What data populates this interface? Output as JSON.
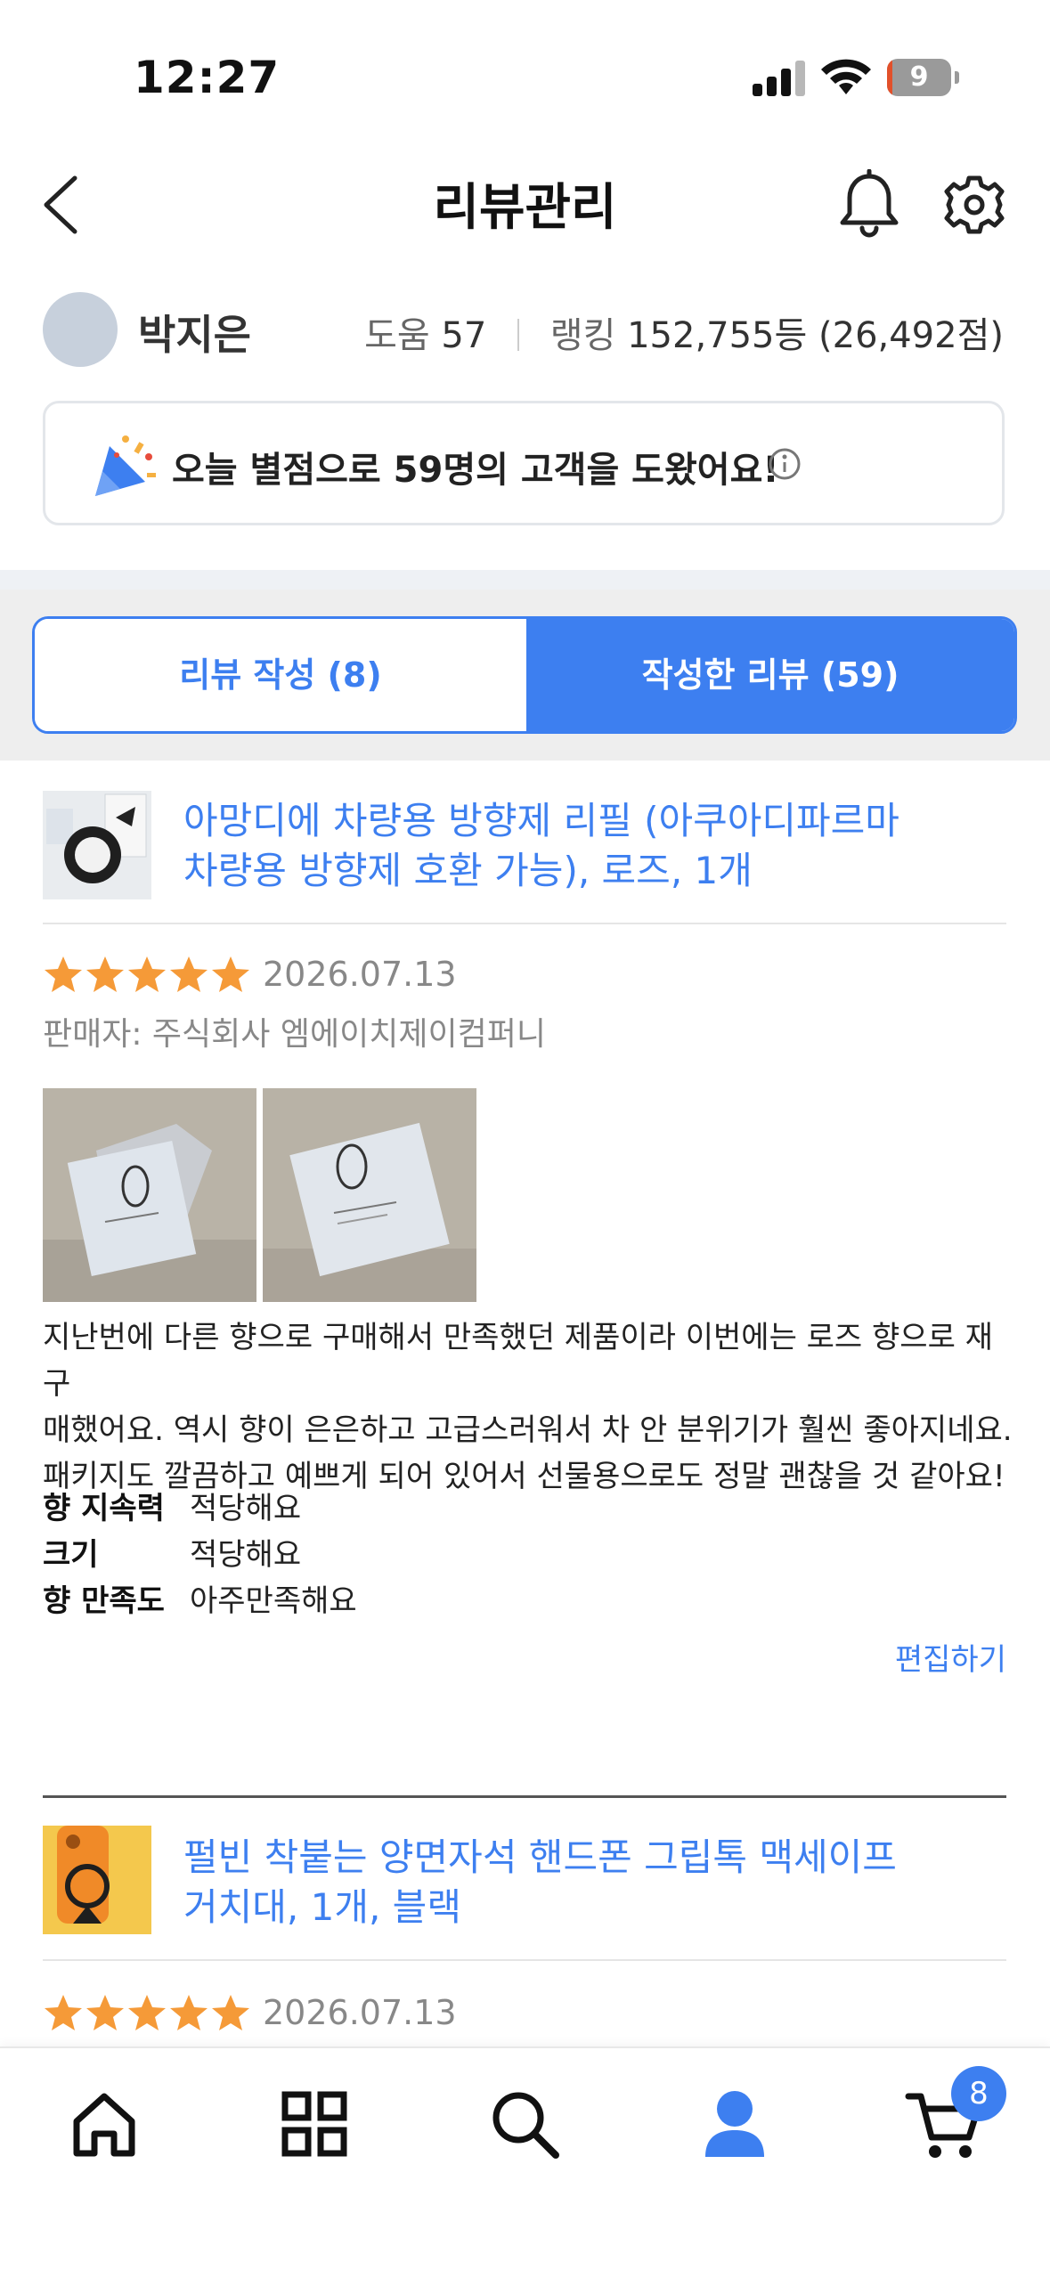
{
  "status_bar": {
    "time": "12:27",
    "battery": "9",
    "battery_level": 0.09
  },
  "header": {
    "title": "리뷰관리"
  },
  "profile": {
    "name": "박지은",
    "help_label": "도움",
    "help_count": "57",
    "ranking_label": "랭킹",
    "ranking_value": "152,755등 (26,492점)"
  },
  "banner": {
    "text": "오늘 별점으로 59명의 고객을 도왔어요!"
  },
  "tabs": [
    {
      "label": "리뷰 작성 (8)",
      "active": false
    },
    {
      "label": "작성한 리뷰 (59)",
      "active": true
    }
  ],
  "reviews": [
    {
      "product_title_line1": "아망디에 차량용 방향제 리필 (아쿠아디파르마",
      "product_title_line2": "차량용 방향제 호환 가능), 로즈, 1개",
      "rating": 5,
      "date": "2026.07.13",
      "seller": "판매자: 주식회사 엠에이치제이컴퍼니",
      "body_lines": [
        "지난번에 다른 향으로 구매해서 만족했던 제품이라 이번에는 로즈 향으로 재구",
        "매했어요. 역시 향이 은은하고 고급스러워서 차 안 분위기가 훨씬 좋아지네요.",
        "패키지도 깔끔하고 예쁘게 되어 있어서 선물용으로도 정말 괜찮을 것 같아요!"
      ],
      "attributes": [
        {
          "key": "향 지속력",
          "value": "적당해요"
        },
        {
          "key": "크기",
          "value": "적당해요"
        },
        {
          "key": "향 만족도",
          "value": "아주만족해요"
        }
      ],
      "edit_label": "편집하기"
    },
    {
      "product_title_line1": "펄빈 착붙는 양면자석 핸드폰 그립톡 맥세이프",
      "product_title_line2": "거치대, 1개, 블랙",
      "rating": 5,
      "date": "2026.07.13"
    }
  ],
  "bottom_nav": {
    "items": [
      "home-icon",
      "categories-icon",
      "search-icon",
      "my-page-icon",
      "cart-icon"
    ],
    "cart_badge": "8"
  },
  "colors": {
    "accent": "#3d7ff0",
    "star": "#f59a38"
  }
}
